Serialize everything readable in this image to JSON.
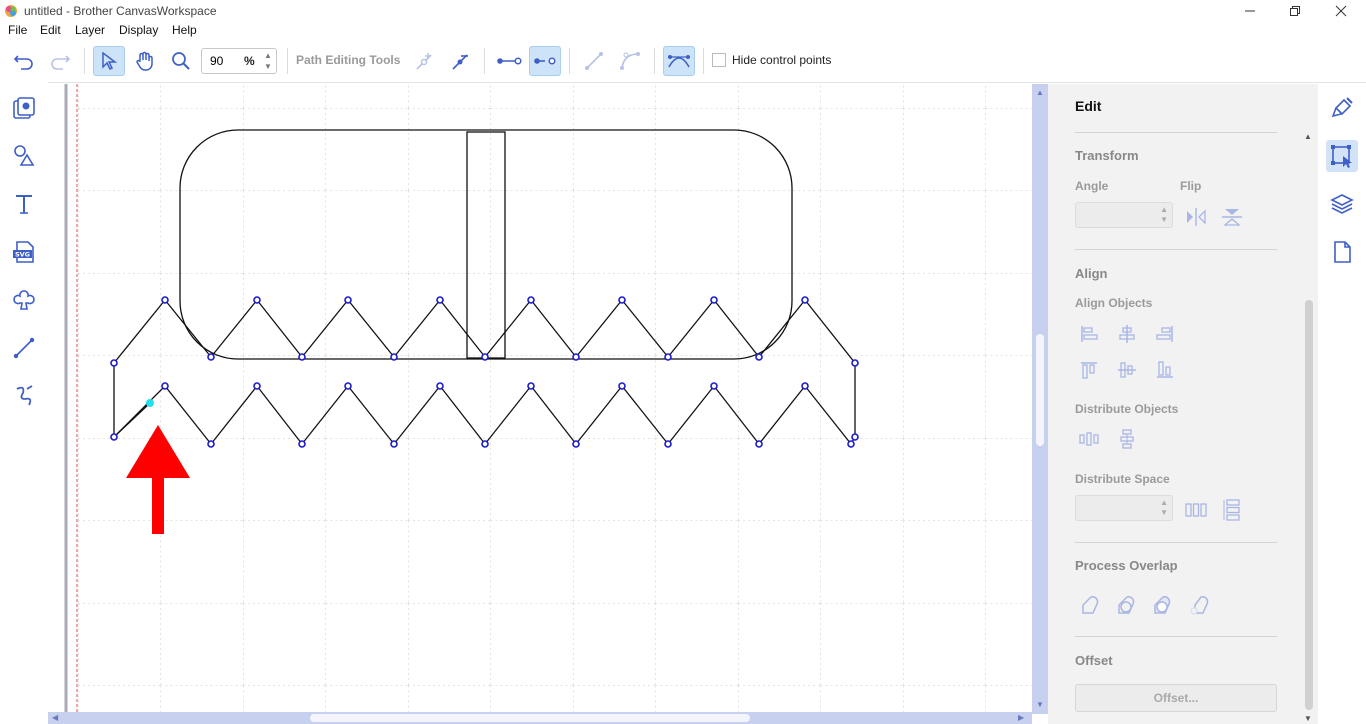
{
  "window": {
    "title": "untitled - Brother CanvasWorkspace",
    "controls": [
      "minimize",
      "restore",
      "close"
    ]
  },
  "menu": [
    "File",
    "Edit",
    "Layer",
    "Display",
    "Help"
  ],
  "toolbar": {
    "zoom_value": "90",
    "zoom_unit": "%",
    "path_tools_label": "Path Editing Tools",
    "hide_control_points_label": "Hide control points",
    "hide_control_points_checked": false
  },
  "panel": {
    "title": "Edit",
    "transform": {
      "heading": "Transform",
      "angle_label": "Angle",
      "flip_label": "Flip",
      "angle_value": ""
    },
    "align": {
      "heading": "Align",
      "align_objects_label": "Align Objects",
      "distribute_objects_label": "Distribute Objects",
      "distribute_space_label": "Distribute Space",
      "distribute_space_value": ""
    },
    "process_overlap": {
      "heading": "Process Overlap"
    },
    "offset": {
      "heading": "Offset",
      "button_label": "Offset..."
    }
  },
  "colors": {
    "accent": "#3f5fc8",
    "node": "#1a1ad0",
    "selected_node": "#22e0f0",
    "arrow": "#ff0000",
    "scrollbar": "#c8d0ef",
    "panel_bg": "#f2f2f2"
  }
}
